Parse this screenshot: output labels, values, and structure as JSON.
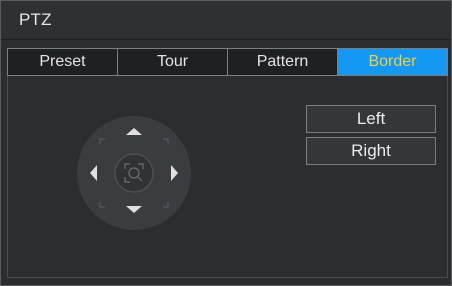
{
  "window": {
    "title": "PTZ"
  },
  "tabs": [
    {
      "label": "Preset",
      "active": false
    },
    {
      "label": "Tour",
      "active": false
    },
    {
      "label": "Pattern",
      "active": false
    },
    {
      "label": "Border",
      "active": true
    }
  ],
  "buttons": {
    "left_label": "Left",
    "right_label": "Right"
  },
  "ptz_control": {
    "icons": [
      "arrow-up-icon",
      "arrow-down-icon",
      "arrow-left-icon",
      "arrow-right-icon",
      "zoom-center-icon"
    ]
  },
  "colors": {
    "active_tab_bg": "#1398f4",
    "active_tab_text": "#f2cf3c",
    "panel_bg": "#2b2d31"
  }
}
